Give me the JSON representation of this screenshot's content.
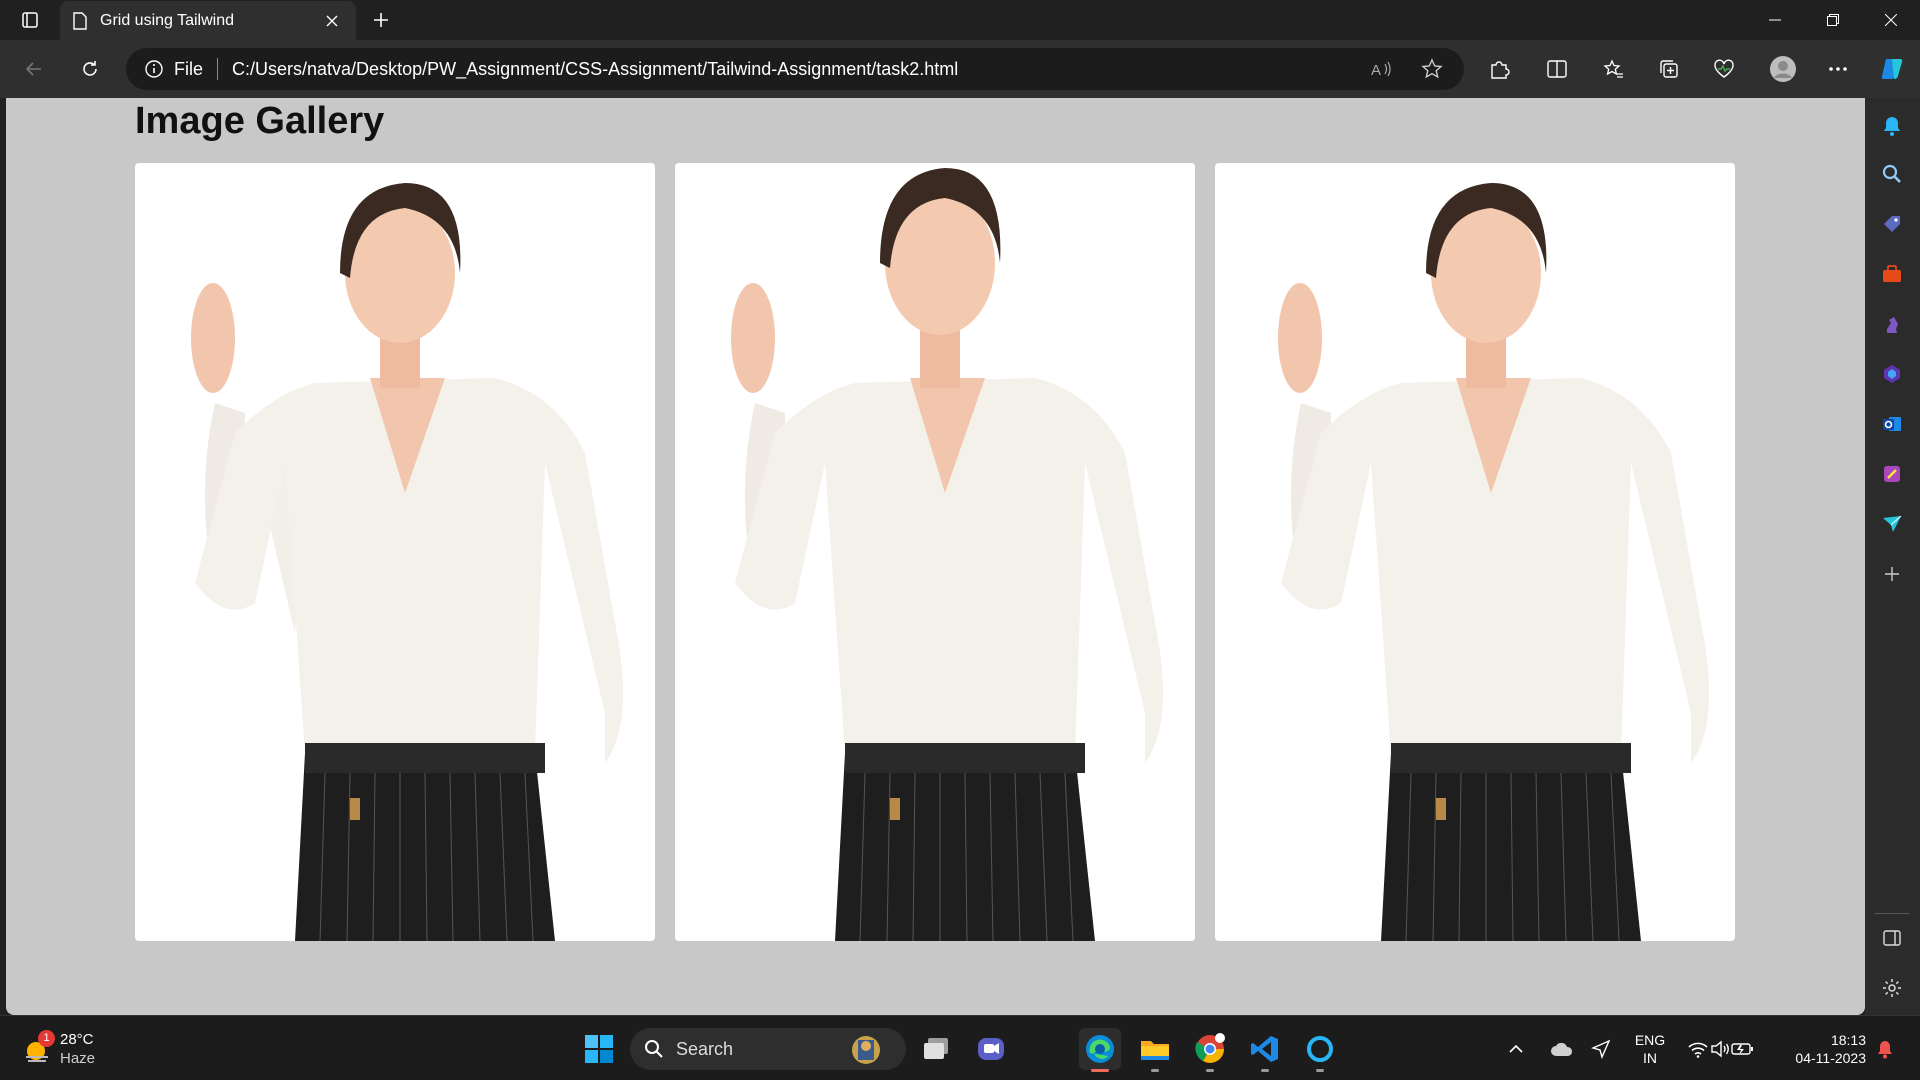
{
  "tab": {
    "title": "Grid using Tailwind"
  },
  "address": {
    "prefix": "File",
    "url": "C:/Users/natva/Desktop/PW_Assignment/CSS-Assignment/Tailwind-Assignment/task2.html"
  },
  "page": {
    "title": "Image Gallery",
    "image_count": 3
  },
  "taskbar": {
    "weather": {
      "badge": "1",
      "temp": "28°C",
      "condition": "Haze"
    },
    "search_label": "Search",
    "lang": {
      "line1": "ENG",
      "line2": "IN"
    },
    "clock": {
      "time": "18:13",
      "date": "04-11-2023"
    }
  },
  "colors": {
    "page_bg": "#c8c8c8",
    "accent": "#0078d4"
  }
}
